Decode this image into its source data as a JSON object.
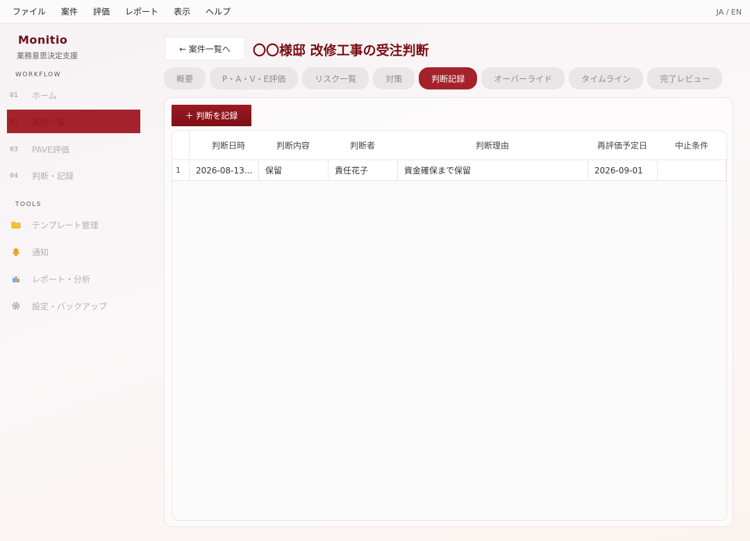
{
  "menubar": {
    "items": [
      "ファイル",
      "案件",
      "評価",
      "レポート",
      "表示",
      "ヘルプ"
    ],
    "lang": "JA / EN"
  },
  "sidebar": {
    "brand": "Monitio",
    "subtitle": "業務意思決定支援",
    "workflow_label": "WORKFLOW",
    "workflow": [
      {
        "num": "01",
        "label": "ホーム"
      },
      {
        "num": "02",
        "label": "案件一覧"
      },
      {
        "num": "03",
        "label": "PAVE評価"
      },
      {
        "num": "04",
        "label": "判断・記録"
      }
    ],
    "tools_label": "TOOLS",
    "tools": [
      {
        "icon": "folder-icon",
        "label": "テンプレート管理",
        "color": "#f2c230"
      },
      {
        "icon": "bell-icon",
        "label": "通知",
        "color": "#f0a21d"
      },
      {
        "icon": "bar-chart-icon",
        "label": "レポート・分析",
        "color": "#4c9be8"
      },
      {
        "icon": "gear-icon",
        "label": "設定・バックアップ",
        "color": "#9aa0a8"
      }
    ]
  },
  "header": {
    "back": "← 案件一覧へ",
    "title": "〇〇様邸 改修工事の受注判断"
  },
  "tabs": [
    "概要",
    "P・A・V・E評価",
    "リスク一覧",
    "対策",
    "判断記録",
    "オーバーライド",
    "タイムライン",
    "完了レビュー"
  ],
  "active_tab": "判断記録",
  "actions": {
    "record": "＋ 判断を記録"
  },
  "table": {
    "columns": [
      "判断日時",
      "判断内容",
      "判断者",
      "判断理由",
      "再評価予定日",
      "中止条件"
    ],
    "rows": [
      {
        "index": "1",
        "cells": [
          "2026-08-13...",
          "保留",
          "責任花子",
          "資金確保まで保留",
          "2026-09-01",
          ""
        ]
      }
    ]
  },
  "colors": {
    "accent": "#a4222b",
    "title": "#7a0d12"
  }
}
